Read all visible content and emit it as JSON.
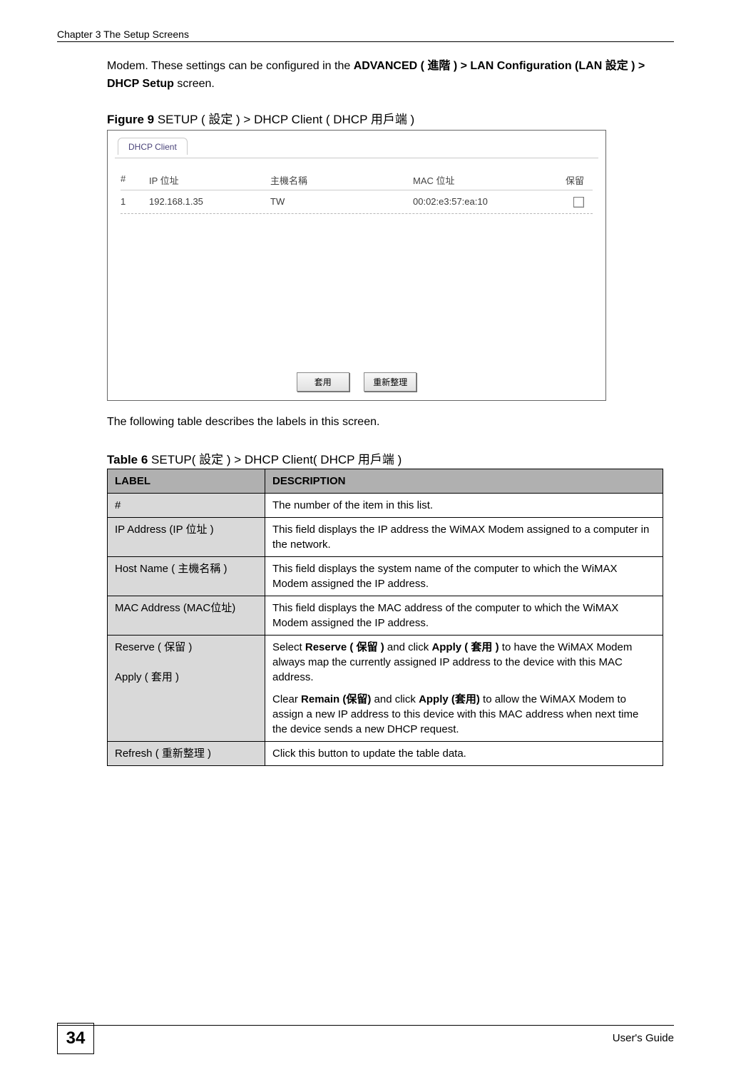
{
  "header": {
    "running": "Chapter 3 The Setup Screens"
  },
  "intro": {
    "p1_prefix": "Modem. These settings can be configured in the ",
    "p1_bold1": "ADVANCED ( 進階 ) > LAN Configuration (LAN 設定 ) > DHCP Setup",
    "p1_suffix": " screen."
  },
  "figure": {
    "label": "Figure 9",
    "title": "   SETUP  ( 設定 ) > DHCP Client  ( DHCP 用戶端 )"
  },
  "screenshot": {
    "tab_label": "DHCP Client",
    "columns": {
      "num": "#",
      "ip": "IP 位址",
      "host": "主機名稱",
      "mac": "MAC 位址",
      "reserve": "保留"
    },
    "row": {
      "num": "1",
      "ip": "192.168.1.35",
      "host": "TW",
      "mac": "00:02:e3:57:ea:10"
    },
    "buttons": {
      "apply": "套用",
      "refresh": "重新整理"
    }
  },
  "para2": "The following table describes the labels in this screen.",
  "table_caption": {
    "label": "Table 6",
    "title": "   SETUP( 設定 ) > DHCP Client( DHCP 用戶端 )"
  },
  "def_table": {
    "header_label": "LABEL",
    "header_desc": "DESCRIPTION",
    "rows": [
      {
        "label": "#",
        "desc_plain": "The number of the item in this list."
      },
      {
        "label": "IP Address (IP 位址 )",
        "desc_plain": "This field displays the IP address the WiMAX Modem assigned to a computer in the network."
      },
      {
        "label": "Host Name ( 主機名稱 )",
        "desc_plain": "This field displays the system name of the computer to which the WiMAX Modem assigned the IP address."
      },
      {
        "label": "MAC Address (MAC位址)",
        "desc_plain": "This field displays the MAC address of the computer to which the WiMAX Modem assigned the IP address."
      }
    ],
    "reserve_row": {
      "label_line1": "Reserve ( 保留 )",
      "label_line2": "Apply ( 套用 )",
      "p1_pre": "Select ",
      "p1_b1": "Reserve ( 保留 )",
      "p1_mid": " and click ",
      "p1_b2": "Apply ( 套用 )",
      "p1_post": " to have the WiMAX Modem always map the currently assigned IP address to the device with this MAC address.",
      "p2_pre": "Clear ",
      "p2_b1": "Remain (保留)",
      "p2_mid": " and click ",
      "p2_b2": "Apply (套用)",
      "p2_post": " to allow the WiMAX Modem to assign a new IP address to this device with this MAC address when next time the device sends a new DHCP request."
    },
    "refresh_row": {
      "label": "Refresh ( 重新整理 )",
      "desc_plain": "Click this button to update the table data."
    }
  },
  "footer": {
    "page_number": "34",
    "guide": "User's Guide"
  }
}
